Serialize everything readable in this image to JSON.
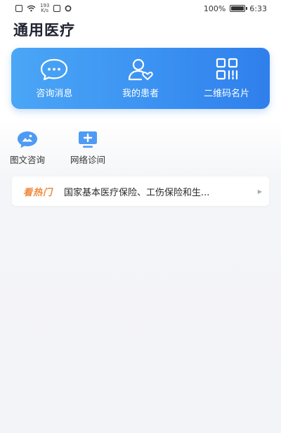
{
  "status_bar": {
    "speed_value": "193",
    "speed_unit": "K/s",
    "battery": "100%",
    "time": "6:33"
  },
  "app": {
    "title": "通用医疗"
  },
  "hero": {
    "items": [
      {
        "label": "咨询消息",
        "icon": "chat-bubble-icon"
      },
      {
        "label": "我的患者",
        "icon": "patient-heart-icon"
      },
      {
        "label": "二维码名片",
        "icon": "qr-code-icon"
      }
    ],
    "colors": {
      "start": "#4aa6f6",
      "end": "#2f7fec"
    }
  },
  "quick_actions": [
    {
      "label": "图文咨询",
      "icon": "image-chat-icon"
    },
    {
      "label": "网络诊间",
      "icon": "monitor-plus-icon"
    }
  ],
  "news": {
    "tag": "看热门",
    "headline": "国家基本医疗保险、工伤保险和生...",
    "tag_color": "#f0883a"
  }
}
